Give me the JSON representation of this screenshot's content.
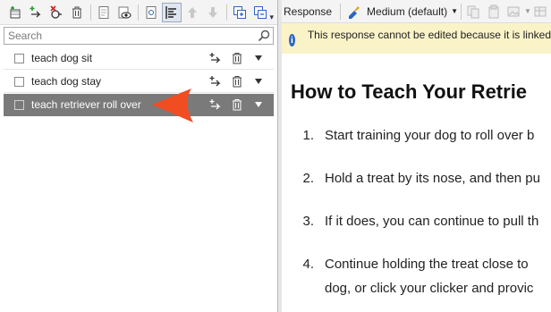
{
  "left_panel": {
    "search_placeholder": "Search",
    "items": [
      {
        "label": "teach dog sit",
        "selected": false
      },
      {
        "label": "teach dog stay",
        "selected": false
      },
      {
        "label": "teach retriever roll over",
        "selected": true
      }
    ]
  },
  "right_panel": {
    "toolbar": {
      "title": "Response",
      "style_select": "Medium (default)"
    },
    "info_message": "This response cannot be edited because it is linked",
    "heading": "How to Teach Your Retrie",
    "steps": [
      {
        "num": "1.",
        "lines": [
          "Start training your dog to roll over b"
        ]
      },
      {
        "num": "2.",
        "lines": [
          "Hold a treat by its nose, and then pu"
        ]
      },
      {
        "num": "3.",
        "lines": [
          "If it does, you can continue to pull th"
        ]
      },
      {
        "num": "4.",
        "lines": [
          "Continue holding the treat close to",
          "dog, or click your clicker and provic"
        ]
      }
    ]
  },
  "colors": {
    "selected_row": "#7a7a7a",
    "info_bar": "#fbf3c8",
    "callout_arrow": "#f04d23"
  }
}
